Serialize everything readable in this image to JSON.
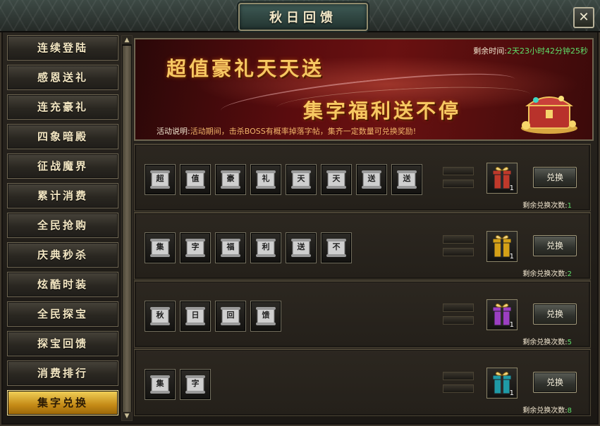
{
  "window": {
    "title": "秋日回馈",
    "close_label": "✕"
  },
  "sidebar": {
    "items": [
      {
        "label": "连续登陆"
      },
      {
        "label": "感恩送礼"
      },
      {
        "label": "连充豪礼"
      },
      {
        "label": "四象暗殿"
      },
      {
        "label": "征战魔界"
      },
      {
        "label": "累计消费"
      },
      {
        "label": "全民抢购"
      },
      {
        "label": "庆典秒杀"
      },
      {
        "label": "炫酷时装"
      },
      {
        "label": "全民探宝"
      },
      {
        "label": "探宝回馈"
      },
      {
        "label": "消费排行"
      },
      {
        "label": "集字兑换"
      }
    ],
    "active_index": 12
  },
  "banner": {
    "slogan_top": "超值豪礼天天送",
    "slogan_bottom": "集字福利送不停",
    "timer_label": "剩余时间:",
    "timer_value": "2天23小时42分钟25秒",
    "desc_label": "活动说明:",
    "desc_text": "活动期间，击杀BOSS有概率掉落字帖，集齐一定数量可兑换奖励!"
  },
  "rows": [
    {
      "scrolls": [
        "超",
        "值",
        "豪",
        "礼",
        "天",
        "天",
        "送",
        "送"
      ],
      "gift_count": "1",
      "gift_color": "#c0392b",
      "button": "兑换",
      "remain_label": "剩余兑换次数:",
      "remain_value": "1"
    },
    {
      "scrolls": [
        "集",
        "字",
        "福",
        "利",
        "送",
        "不"
      ],
      "gift_count": "1",
      "gift_color": "#d4a017",
      "button": "兑换",
      "remain_label": "剩余兑换次数:",
      "remain_value": "2"
    },
    {
      "scrolls": [
        "秋",
        "日",
        "回",
        "馈"
      ],
      "gift_count": "1",
      "gift_color": "#9b3fc2",
      "button": "兑换",
      "remain_label": "剩余兑换次数:",
      "remain_value": "5"
    },
    {
      "scrolls": [
        "集",
        "字"
      ],
      "gift_count": "1",
      "gift_color": "#1f9aa6",
      "button": "兑换",
      "remain_label": "剩余兑换次数:",
      "remain_value": "8"
    }
  ]
}
